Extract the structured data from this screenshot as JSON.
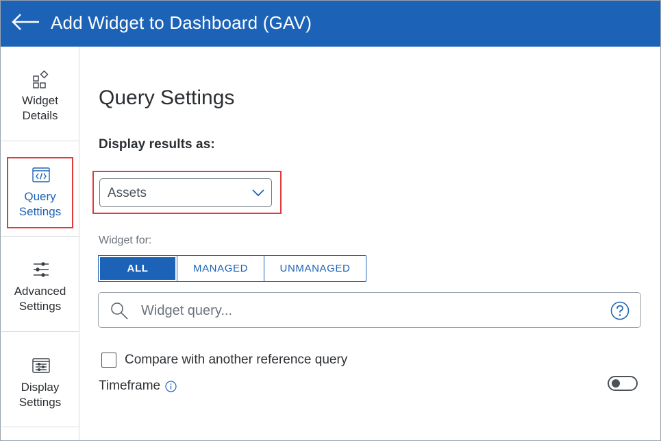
{
  "header": {
    "title": "Add Widget to Dashboard (GAV)",
    "back_icon": "arrow-left-icon",
    "background_color": "#1c63b7"
  },
  "sidebar": {
    "items": [
      {
        "label": "Widget\nDetails",
        "icon": "widget-shapes-icon",
        "active": false
      },
      {
        "label": "Query\nSettings",
        "icon": "code-window-icon",
        "active": true
      },
      {
        "label": "Advanced\nSettings",
        "icon": "sliders-icon",
        "active": false
      },
      {
        "label": "Display\nSettings",
        "icon": "display-list-icon",
        "active": false
      }
    ]
  },
  "main": {
    "heading": "Query Settings",
    "display_results_label": "Display results as:",
    "display_results_value": "Assets",
    "widget_for_label": "Widget for:",
    "widget_for_options": [
      "ALL",
      "MANAGED",
      "UNMANAGED"
    ],
    "widget_for_selected": "ALL",
    "search": {
      "placeholder": "Widget query...",
      "value": ""
    },
    "compare_label": "Compare with another reference query",
    "compare_checked": false,
    "timeframe_label": "Timeframe",
    "timeframe_enabled": false
  },
  "colors": {
    "accent": "#1c63b7",
    "highlight": "#e03a3a"
  }
}
